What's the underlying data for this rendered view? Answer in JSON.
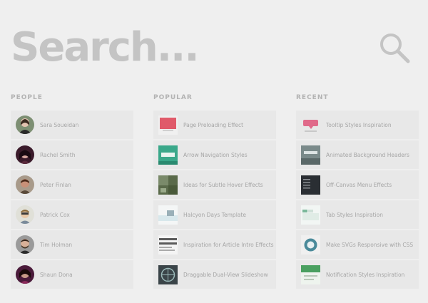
{
  "search": {
    "placeholder": "Search..."
  },
  "icons": {
    "search": "search-icon"
  },
  "colors": {
    "background": "#efefef",
    "item_background": "#e8e8e8",
    "text": "#a6a6a6",
    "heading": "#b3b3b3",
    "search_text": "#c4c4c4"
  },
  "people": {
    "title": "PEOPLE",
    "items": [
      {
        "label": "Sara Soueidan",
        "avatar_color": "#6b7b6a"
      },
      {
        "label": "Rachel Smith",
        "avatar_color": "#5a2a3c"
      },
      {
        "label": "Peter Finlan",
        "avatar_color": "#8a5a4a"
      },
      {
        "label": "Patrick Cox",
        "avatar_color": "#c8c8c0"
      },
      {
        "label": "Tim Holman",
        "avatar_color": "#6a6a6a"
      },
      {
        "label": "Shaun Dona",
        "avatar_color": "#7a3a5a"
      }
    ]
  },
  "popular": {
    "title": "POPULAR",
    "items": [
      {
        "label": "Page Preloading Effect",
        "thumb_color": "#e05a6a"
      },
      {
        "label": "Arrow Navigation Styles",
        "thumb_color": "#3aa88a"
      },
      {
        "label": "Ideas for Subtle Hover Effects",
        "thumb_color": "#6a7a5a"
      },
      {
        "label": "Halcyon Days Template",
        "thumb_color": "#dfe8ec"
      },
      {
        "label": "Inspiration for Article Intro Effects",
        "thumb_color": "#ececec"
      },
      {
        "label": "Draggable Dual-View Slideshow",
        "thumb_color": "#3a4448"
      }
    ]
  },
  "recent": {
    "title": "RECENT",
    "items": [
      {
        "label": "Tooltip Styles Inspiration",
        "thumb_color": "#e06a8a"
      },
      {
        "label": "Animated Background Headers",
        "thumb_color": "#7a8a8a"
      },
      {
        "label": "Off-Canvas Menu Effects",
        "thumb_color": "#2a2e33"
      },
      {
        "label": "Tab Styles Inspiration",
        "thumb_color": "#e4ece8"
      },
      {
        "label": "Make SVGs Responsive with CSS",
        "thumb_color": "#4a8a9a"
      },
      {
        "label": "Notification Styles Inspiration",
        "thumb_color": "#4aa060"
      }
    ]
  }
}
